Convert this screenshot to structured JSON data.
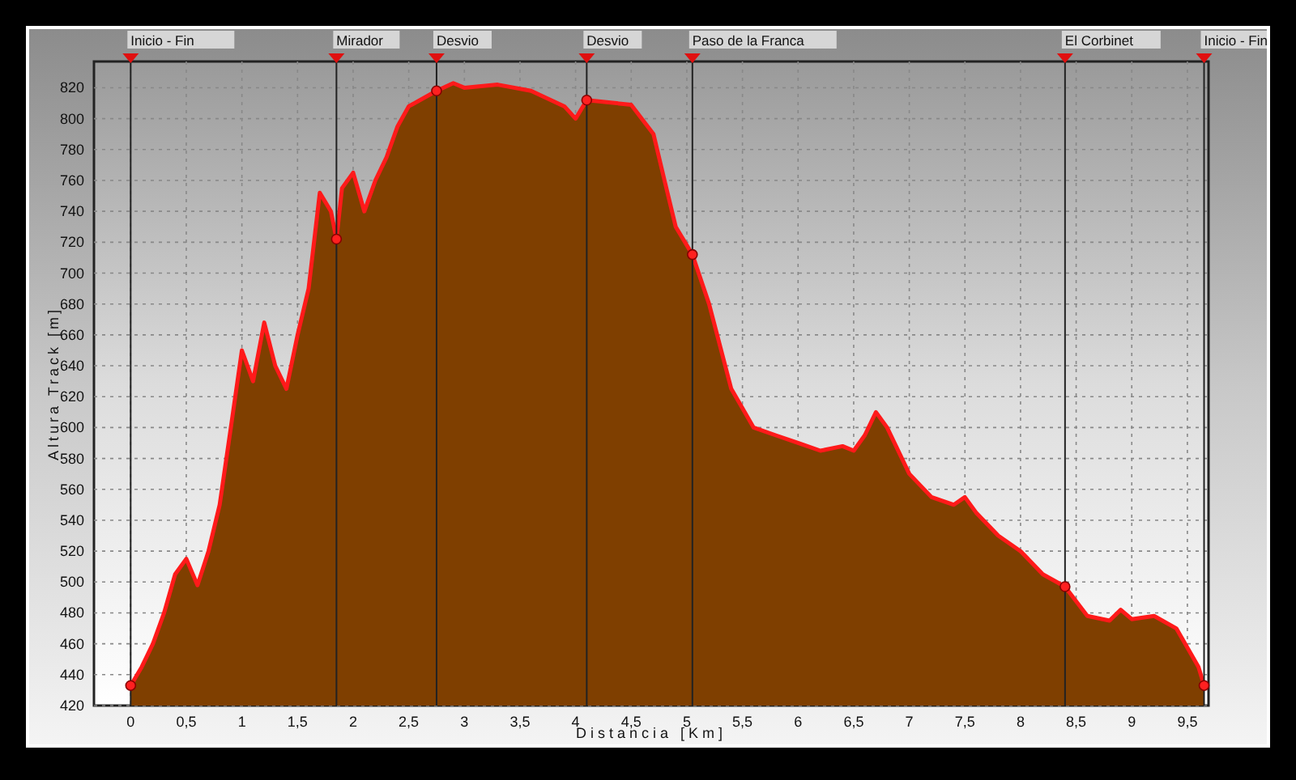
{
  "chart_data": {
    "type": "area",
    "xlabel": "Distancia [Km]",
    "ylabel": "Altura Track [m]",
    "x": [
      0,
      0.1,
      0.2,
      0.3,
      0.4,
      0.5,
      0.6,
      0.7,
      0.8,
      0.9,
      1.0,
      1.1,
      1.2,
      1.3,
      1.4,
      1.5,
      1.6,
      1.7,
      1.8,
      1.85,
      1.9,
      2.0,
      2.1,
      2.2,
      2.3,
      2.4,
      2.5,
      2.6,
      2.75,
      2.9,
      3.0,
      3.3,
      3.6,
      3.9,
      4.0,
      4.1,
      4.5,
      4.7,
      4.8,
      4.9,
      5.05,
      5.2,
      5.4,
      5.6,
      5.8,
      6.0,
      6.2,
      6.4,
      6.5,
      6.6,
      6.7,
      6.8,
      7.0,
      7.2,
      7.4,
      7.5,
      7.6,
      7.8,
      8.0,
      8.2,
      8.4,
      8.6,
      8.8,
      8.9,
      9.0,
      9.2,
      9.4,
      9.6,
      9.65
    ],
    "grid": true,
    "series": [
      {
        "color": "#7f3f00",
        "values": [
          433,
          445,
          460,
          480,
          505,
          515,
          498,
          520,
          550,
          600,
          650,
          630,
          668,
          640,
          625,
          660,
          690,
          752,
          740,
          722,
          755,
          765,
          740,
          760,
          775,
          795,
          808,
          812,
          818,
          823,
          820,
          822,
          818,
          808,
          800,
          812,
          809,
          790,
          760,
          730,
          712,
          680,
          625,
          600,
          595,
          590,
          585,
          588,
          585,
          595,
          610,
          600,
          570,
          555,
          550,
          555,
          545,
          530,
          520,
          505,
          497,
          478,
          475,
          482,
          476,
          478,
          470,
          445,
          433
        ]
      }
    ],
    "xlim": [
      -0.33,
      9.69
    ],
    "ylim": [
      420,
      837
    ],
    "xticks": [
      0,
      {
        "value": 0.5,
        "label": "0,5"
      },
      1,
      {
        "value": 1.5,
        "label": "1,5"
      },
      2,
      {
        "value": 2.5,
        "label": "2,5"
      },
      3,
      {
        "value": 3.5,
        "label": "3,5"
      },
      4,
      {
        "value": 4.5,
        "label": "4,5"
      },
      5,
      {
        "value": 5.5,
        "label": "5,5"
      },
      6,
      {
        "value": 6.5,
        "label": "6,5"
      },
      7,
      {
        "value": 7.5,
        "label": "7,5"
      },
      8,
      {
        "value": 8.5,
        "label": "8,5"
      },
      9,
      {
        "value": 9.5,
        "label": "9,5"
      }
    ],
    "yticks": [
      420,
      440,
      460,
      480,
      500,
      520,
      540,
      560,
      580,
      600,
      620,
      640,
      660,
      680,
      700,
      720,
      740,
      760,
      780,
      800,
      820
    ],
    "ref_lines": [
      {
        "axis": "x",
        "value": 0,
        "label": "Inicio - Fin"
      },
      {
        "axis": "x",
        "value": 1.85,
        "label": "Mirador"
      },
      {
        "axis": "x",
        "value": 2.75,
        "label": "Desvio"
      },
      {
        "axis": "x",
        "value": 4.1,
        "label": "Desvio"
      },
      {
        "axis": "x",
        "value": 5.05,
        "label": "Paso de la Franca"
      },
      {
        "axis": "x",
        "value": 8.4,
        "label": "El Corbinet"
      },
      {
        "axis": "x",
        "value": 9.65,
        "label": "Inicio - Fin"
      }
    ]
  }
}
